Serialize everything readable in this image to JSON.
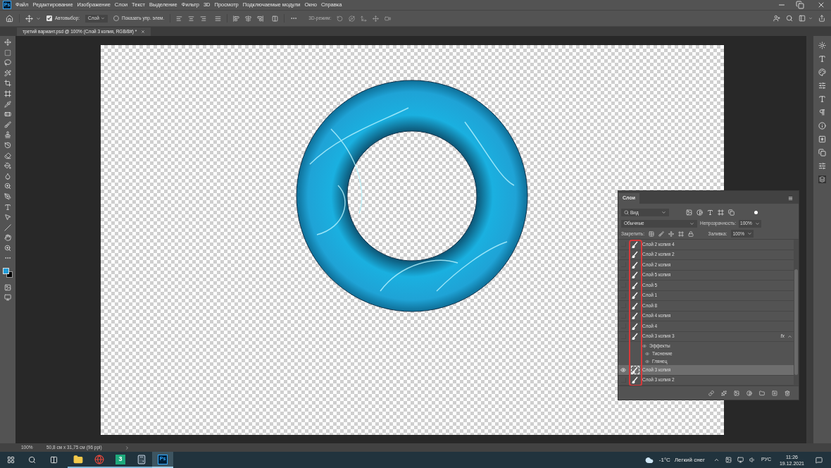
{
  "app_logo": "Ps",
  "menu": [
    "Файл",
    "Редактирование",
    "Изображение",
    "Слои",
    "Текст",
    "Выделение",
    "Фильтр",
    "3D",
    "Просмотр",
    "Подключаемые модули",
    "Окно",
    "Справка"
  ],
  "options_bar": {
    "auto_select": {
      "label": "Автовыбор:",
      "checked": true
    },
    "auto_select_target": "Слой",
    "show_controls": {
      "label": "Показать упр. элем.",
      "checked": false
    },
    "mode_3d": "3D-режим:"
  },
  "document_tab": {
    "title": "третий  вариант.psd @ 100% (Слой 3 копия, RGB/8#) *",
    "selected": true
  },
  "swatches": [
    {
      "kind": "foreground",
      "color": "#1e9bd7"
    },
    {
      "kind": "background",
      "color": "#000000"
    }
  ],
  "layers_panel": {
    "title": "Слои",
    "filter": "Вид",
    "blend_mode": "Обычные",
    "opacity_label": "Непрозрачность:",
    "opacity": "100%",
    "lock_label": "Закрепить:",
    "fill_label": "Заливка:",
    "fill": "100%",
    "layers": [
      {
        "name": "Слой 2 копия 4",
        "visible": false,
        "selected": false
      },
      {
        "name": "Слой 2 копия 2",
        "visible": false,
        "selected": false
      },
      {
        "name": "Слой 2 копия",
        "visible": false,
        "selected": false
      },
      {
        "name": "Слой 5 копия",
        "visible": false,
        "selected": false
      },
      {
        "name": "Слой 5",
        "visible": false,
        "selected": false
      },
      {
        "name": "Слой 1",
        "visible": false,
        "selected": false
      },
      {
        "name": "Слой 8",
        "visible": false,
        "selected": false
      },
      {
        "name": "Слой 4 копия",
        "visible": false,
        "selected": false
      },
      {
        "name": "Слой 4",
        "visible": false,
        "selected": false
      },
      {
        "name": "Слой 3 копия 3",
        "visible": false,
        "selected": false,
        "fx": "fx",
        "effects": {
          "label": "Эффекты",
          "expanded": true,
          "children": [
            "Тиснение",
            "Глянец"
          ]
        }
      },
      {
        "name": "Слой 3 копия",
        "visible": true,
        "selected": true
      },
      {
        "name": "Слой 3 копия 2",
        "visible": false,
        "selected": false
      }
    ]
  },
  "status_bar": {
    "zoom": "100%",
    "document_size": "50,8 см x 31,75 см (96 ppi)"
  },
  "taskbar": {
    "apps": [
      {
        "kind": "files",
        "selected": false
      },
      {
        "kind": "browser",
        "selected": false
      },
      {
        "kind": "tile",
        "label": "3",
        "selected": false
      },
      {
        "kind": "calculator",
        "selected": false
      },
      {
        "kind": "photoshop",
        "label": "Ps",
        "selected": true
      }
    ],
    "temperature": "-1°C",
    "weather": "Легкий снег",
    "language": "РУС",
    "time": "11:26",
    "date": "19.12.2021"
  }
}
